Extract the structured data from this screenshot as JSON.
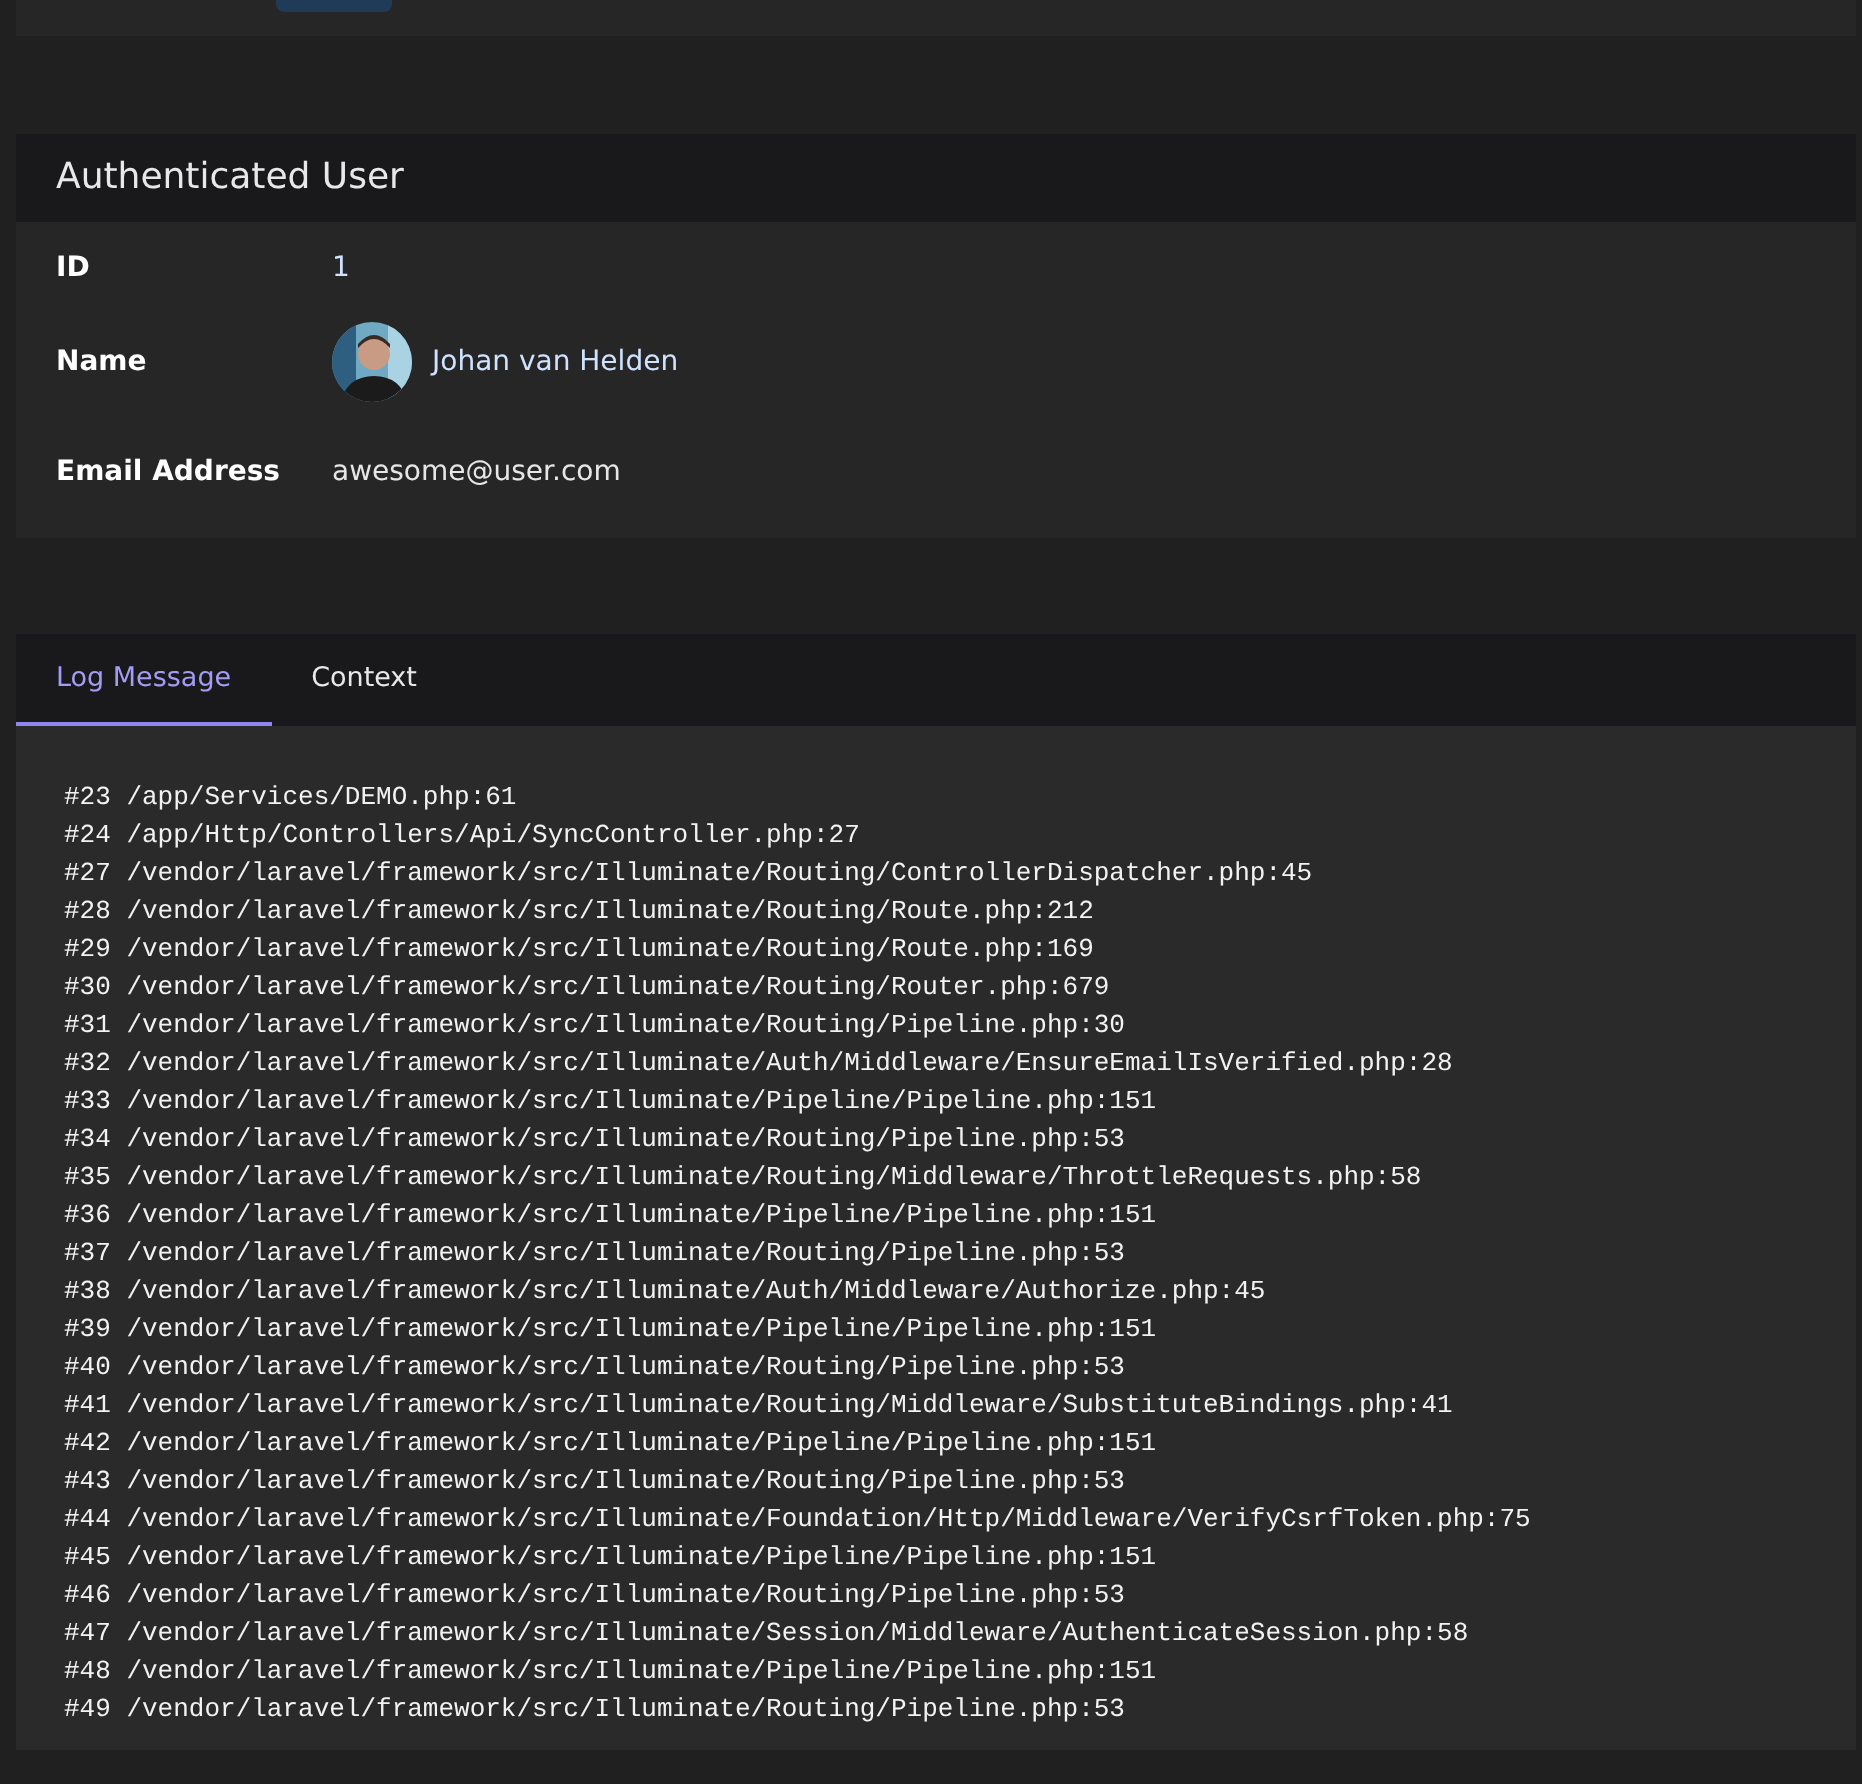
{
  "top_card": {
    "buttons": [
      {
        "kind": "primary"
      }
    ]
  },
  "user_card": {
    "title": "Authenticated User",
    "rows": [
      {
        "kind": "text",
        "label": "ID",
        "value": "1"
      },
      {
        "kind": "avatar",
        "label": "Name",
        "value": "Johan van Helden"
      },
      {
        "kind": "plain",
        "label": "Email Address",
        "value": "awesome@user.com"
      }
    ]
  },
  "log_card": {
    "tabs": [
      {
        "label": "Log Message",
        "selected": true
      },
      {
        "label": "Context",
        "selected": false
      }
    ],
    "lines": [
      "#23 /app/Services/DEMO.php:61",
      "#24 /app/Http/Controllers/Api/SyncController.php:27",
      "#27 /vendor/laravel/framework/src/Illuminate/Routing/ControllerDispatcher.php:45",
      "#28 /vendor/laravel/framework/src/Illuminate/Routing/Route.php:212",
      "#29 /vendor/laravel/framework/src/Illuminate/Routing/Route.php:169",
      "#30 /vendor/laravel/framework/src/Illuminate/Routing/Router.php:679",
      "#31 /vendor/laravel/framework/src/Illuminate/Routing/Pipeline.php:30",
      "#32 /vendor/laravel/framework/src/Illuminate/Auth/Middleware/EnsureEmailIsVerified.php:28",
      "#33 /vendor/laravel/framework/src/Illuminate/Pipeline/Pipeline.php:151",
      "#34 /vendor/laravel/framework/src/Illuminate/Routing/Pipeline.php:53",
      "#35 /vendor/laravel/framework/src/Illuminate/Routing/Middleware/ThrottleRequests.php:58",
      "#36 /vendor/laravel/framework/src/Illuminate/Pipeline/Pipeline.php:151",
      "#37 /vendor/laravel/framework/src/Illuminate/Routing/Pipeline.php:53",
      "#38 /vendor/laravel/framework/src/Illuminate/Auth/Middleware/Authorize.php:45",
      "#39 /vendor/laravel/framework/src/Illuminate/Pipeline/Pipeline.php:151",
      "#40 /vendor/laravel/framework/src/Illuminate/Routing/Pipeline.php:53",
      "#41 /vendor/laravel/framework/src/Illuminate/Routing/Middleware/SubstituteBindings.php:41",
      "#42 /vendor/laravel/framework/src/Illuminate/Pipeline/Pipeline.php:151",
      "#43 /vendor/laravel/framework/src/Illuminate/Routing/Pipeline.php:53",
      "#44 /vendor/laravel/framework/src/Illuminate/Foundation/Http/Middleware/VerifyCsrfToken.php:75",
      "#45 /vendor/laravel/framework/src/Illuminate/Pipeline/Pipeline.php:151",
      "#46 /vendor/laravel/framework/src/Illuminate/Routing/Pipeline.php:53",
      "#47 /vendor/laravel/framework/src/Illuminate/Session/Middleware/AuthenticateSession.php:58",
      "#48 /vendor/laravel/framework/src/Illuminate/Pipeline/Pipeline.php:151",
      "#49 /vendor/laravel/framework/src/Illuminate/Routing/Pipeline.php:53"
    ]
  }
}
